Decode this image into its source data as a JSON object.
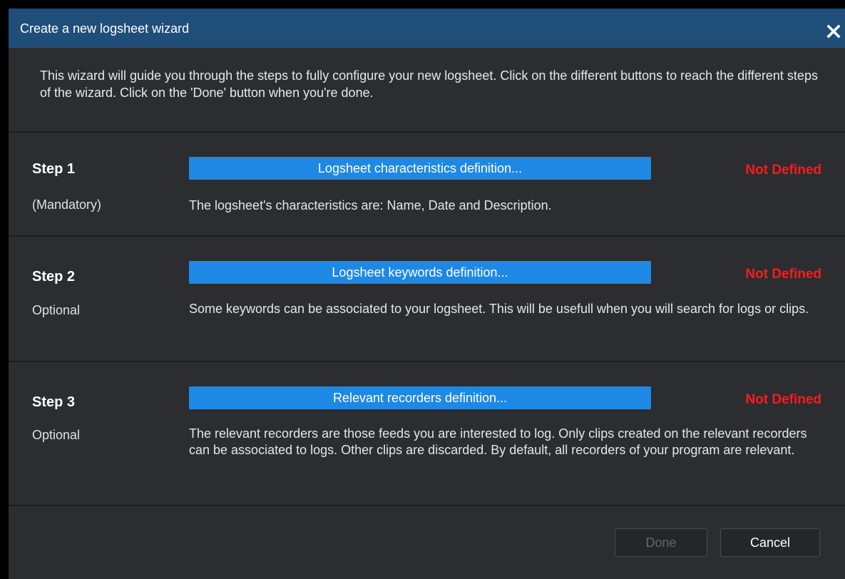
{
  "dialog": {
    "title": "Create a new logsheet wizard",
    "intro": "This wizard will guide you through the steps to fully configure your new logsheet. Click on the different buttons to reach the different steps of the wizard. Click on the 'Done' button when you're done."
  },
  "steps": [
    {
      "title": "Step 1",
      "subtitle": "(Mandatory)",
      "button_label": "Logsheet characteristics definition...",
      "status": "Not Defined",
      "description": "The logsheet's characteristics are: Name, Date and Description."
    },
    {
      "title": "Step 2",
      "subtitle": "Optional",
      "button_label": "Logsheet keywords definition...",
      "status": "Not Defined",
      "description": "Some keywords can be associated to your logsheet. This will be usefull when you will search for logs or clips."
    },
    {
      "title": "Step 3",
      "subtitle": "Optional",
      "button_label": "Relevant recorders definition...",
      "status": "Not Defined",
      "description": "The relevant recorders are those feeds you are interested to log. Only clips created on the relevant recorders can be associated to logs. Other clips are discarded. By default, all recorders of your program are relevant."
    }
  ],
  "footer": {
    "done_label": "Done",
    "cancel_label": "Cancel"
  },
  "colors": {
    "titlebar": "#1f4e79",
    "background": "#2b2d31",
    "step_button": "#1e88e5",
    "status_not_defined": "#ff1a1a"
  },
  "icons": {
    "close": "close-icon"
  }
}
